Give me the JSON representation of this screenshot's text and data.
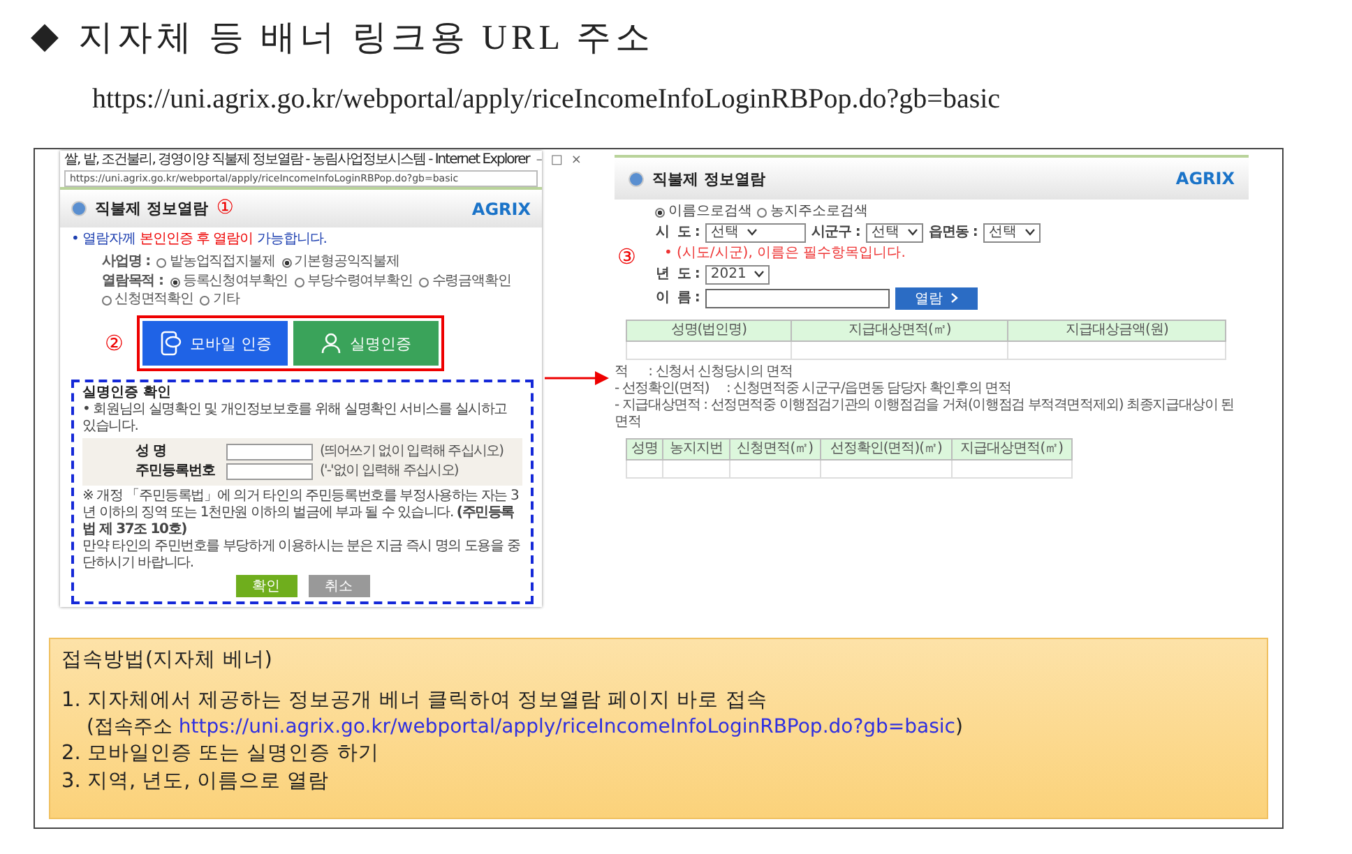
{
  "title": {
    "bullet": "◆",
    "text": "지자체 등 배너 링크용 URL 주소"
  },
  "url": "https://uni.agrix.go.kr/webportal/apply/riceIncomeInfoLoginRBPop.do?gb=basic",
  "left_screenshot": {
    "window_title": "쌀, 밭, 조건불리, 경영이양 직불제 정보열람 - 농림사업정보시스템 - Internet Explorer",
    "window_controls": [
      "–",
      "□",
      "×"
    ],
    "address": "https://uni.agrix.go.kr/webportal/apply/riceIncomeInfoLoginRBPop.do?gb=basic",
    "header": "직불제 정보열람",
    "logo": "AGRIX",
    "step": "①",
    "notice": [
      {
        "text": "• 열람자께 ",
        "highlight": false
      },
      {
        "text": "본인인증 후 열람이",
        "highlight": true
      },
      {
        "text": " 가능합니다.",
        "highlight": false
      }
    ],
    "option_groups": [
      {
        "label": "사업명 :",
        "options": [
          {
            "label": "밭농업직접지불제",
            "selected": false
          },
          {
            "label": "기본형공익직불제",
            "selected": true
          }
        ]
      },
      {
        "label": "열람목적 :",
        "options": [
          {
            "label": "등록신청여부확인",
            "selected": true
          },
          {
            "label": "부당수령여부확인",
            "selected": false
          },
          {
            "label": "수령금액확인",
            "selected": false
          },
          {
            "label": "신청면적확인",
            "selected": false
          },
          {
            "label": "기타",
            "selected": false
          }
        ]
      }
    ],
    "auth_step": "②",
    "auth_buttons": [
      {
        "label": "모바일 인증",
        "kind": "mobile"
      },
      {
        "label": "실명인증",
        "kind": "realname"
      }
    ],
    "realname_dialog": {
      "title": "실명인증 확인",
      "intro": "• 회원님의 실명확인 및 개인정보보호를 위해 실명확인 서비스를 실시하고 있습니다.",
      "fields": [
        {
          "label": "성 명",
          "hint": "(띄어쓰기 없이 입력해 주십시오)"
        },
        {
          "label": "주민등록번호",
          "hint": "('-'없이 입력해 주십시오)"
        }
      ],
      "warning": "※ 개정 「주민등록법」에 의거 타인의 주민등록번호를 부정사용하는 자는 3년 이하의 징역 또는 1천만원 이하의 벌금에 부과 될 수 있습니다. **(주민등록법 제 37조 10호)**",
      "warning_note": "만약 타인의 주민번호를 부당하게 이용하시는 분은 지금 즉시 명의 도용을 중단하시기 바랍니다.",
      "buttons": [
        {
          "label": "확인",
          "kind": "confirm"
        },
        {
          "label": "취소",
          "kind": "cancel"
        }
      ]
    }
  },
  "right_screenshot": {
    "header": "직불제 정보열람",
    "logo": "AGRIX",
    "step": "③",
    "search_modes": [
      {
        "label": "이름으로검색",
        "selected": true
      },
      {
        "label": "농지주소로검색",
        "selected": false
      }
    ],
    "region_filters": [
      {
        "label": "시  도 :",
        "value": "선택"
      },
      {
        "label": "시군구 :",
        "value": "선택"
      },
      {
        "label": "읍면동 :",
        "value": "선택"
      }
    ],
    "required_note": "• (시도/시군), 이름은 필수항목입니다.",
    "year": {
      "label": "년  도 :",
      "value": "2021"
    },
    "name_label": "이  름 :",
    "view_button": "열람",
    "summary_table": {
      "columns": [
        "성명(법인명)",
        "지급대상면적(㎡)",
        "지급대상금액(원)"
      ]
    },
    "notes": [
      "적      : 신청서 신청당시의 면적",
      "- 선정확인(면적)     : 신청면적중 시군구/읍면동 담당자 확인후의 면적",
      "- 지급대상면적 : 선정면적중 이행점검기관의 이행점검을 거쳐(이행점검 부적격면적제외) 최종지급대상이 된 면적"
    ],
    "detail_table": {
      "columns": [
        "성명",
        "농지지번",
        "신청면적(㎡)",
        "선정확인(면적)(㎡)",
        "지급대상면적(㎡)"
      ]
    }
  },
  "access_method": {
    "heading": "접속방법(지자체 베너)",
    "steps": [
      {
        "text": "1.   지자체에서 제공하는 정보공개 베너 클릭하여 정보열람 페이지 바로 접속",
        "prefix": "(접속주소 ",
        "link": "https://uni.agrix.go.kr/webportal/apply/riceIncomeInfoLoginRBPop.do?gb=basic",
        "suffix": ")"
      },
      {
        "text": "2. 모바일인증 또는 실명인증 하기"
      },
      {
        "text": "3. 지역, 년도, 이름으로 열람"
      }
    ]
  }
}
